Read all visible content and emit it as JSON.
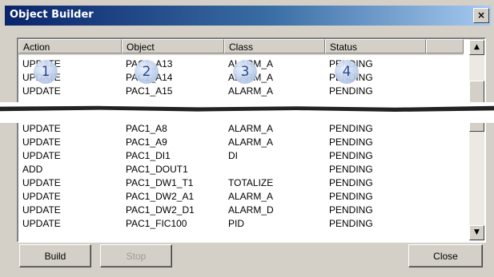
{
  "window": {
    "title": "Object Builder",
    "close_glyph": "×"
  },
  "columns": [
    "Action",
    "Object",
    "Class",
    "Status"
  ],
  "rows_top": [
    {
      "action": "UPDATE",
      "object": "PAC1_A13",
      "class": "ALARM_A",
      "status": "PENDING"
    },
    {
      "action": "UPDATE",
      "object": "PAC1_A14",
      "class": "ALARM_A",
      "status": "PENDING"
    },
    {
      "action": "UPDATE",
      "object": "PAC1_A15",
      "class": "ALARM_A",
      "status": "PENDING"
    }
  ],
  "rows_bottom": [
    {
      "action": "UPDATE",
      "object": "PAC1_A8",
      "class": "ALARM_A",
      "status": "PENDING"
    },
    {
      "action": "UPDATE",
      "object": "PAC1_A9",
      "class": "ALARM_A",
      "status": "PENDING"
    },
    {
      "action": "UPDATE",
      "object": "PAC1_DI1",
      "class": "DI",
      "status": "PENDING"
    },
    {
      "action": "ADD",
      "object": "PAC1_DOUT1",
      "class": "",
      "status": "PENDING"
    },
    {
      "action": "UPDATE",
      "object": "PAC1_DW1_T1",
      "class": "TOTALIZE",
      "status": "PENDING"
    },
    {
      "action": "UPDATE",
      "object": "PAC1_DW2_A1",
      "class": "ALARM_A",
      "status": "PENDING"
    },
    {
      "action": "UPDATE",
      "object": "PAC1_DW2_D1",
      "class": "ALARM_D",
      "status": "PENDING"
    },
    {
      "action": "UPDATE",
      "object": "PAC1_FIC100",
      "class": "PID",
      "status": "PENDING"
    }
  ],
  "badges": [
    "1",
    "2",
    "3",
    "4"
  ],
  "scroll": {
    "up_glyph": "▲",
    "down_glyph": "▼"
  },
  "buttons": {
    "build": "Build",
    "stop": "Stop",
    "close": "Close"
  }
}
